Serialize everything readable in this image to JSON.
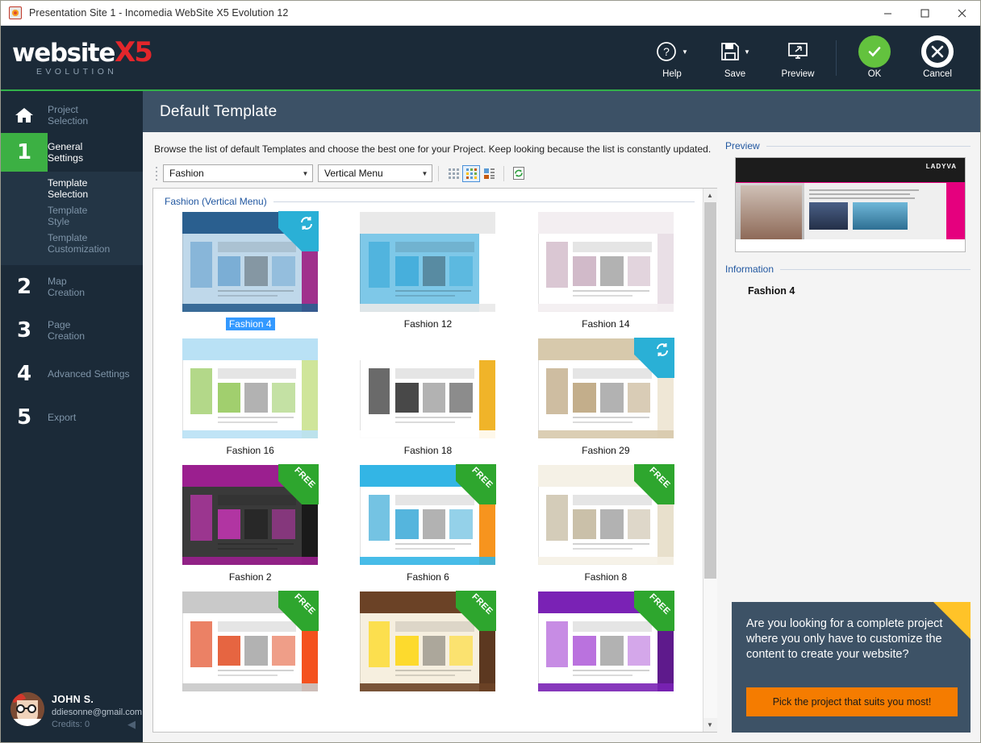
{
  "window": {
    "title": "Presentation Site 1 - Incomedia WebSite X5 Evolution 12",
    "app_icon": "app-logo-icon",
    "minimize": "minimize-icon",
    "maximize": "maximize-icon",
    "close": "close-icon"
  },
  "brand": {
    "line1": "website",
    "accent": "X5",
    "line2": "EVOLUTION",
    "accent_color": "#e3262b"
  },
  "toolbar": {
    "items": [
      {
        "label": "Help",
        "icon": "help-question-icon",
        "has_caret": true
      },
      {
        "label": "Save",
        "icon": "floppy-disk-icon",
        "has_caret": true
      },
      {
        "label": "Preview",
        "icon": "monitor-preview-icon",
        "has_caret": false
      }
    ],
    "ok": {
      "label": "OK",
      "icon": "check-icon",
      "color": "#63c23e"
    },
    "cancel": {
      "label": "Cancel",
      "icon": "cross-icon",
      "color": "#ffffff"
    }
  },
  "sidebar": {
    "home": {
      "label_line1": "Project",
      "label_line2": "Selection",
      "icon": "home-icon"
    },
    "steps": [
      {
        "number": "1",
        "label_line1": "General",
        "label_line2": "Settings",
        "active": true,
        "sub": [
          {
            "label_line1": "Template",
            "label_line2": "Selection",
            "selected": true
          },
          {
            "label_line1": "Template",
            "label_line2": "Style",
            "selected": false
          },
          {
            "label_line1": "Template",
            "label_line2": "Customization",
            "selected": false
          }
        ]
      },
      {
        "number": "2",
        "label_line1": "Map",
        "label_line2": "Creation",
        "active": false,
        "sub": []
      },
      {
        "number": "3",
        "label_line1": "Page",
        "label_line2": "Creation",
        "active": false,
        "sub": []
      },
      {
        "number": "4",
        "label_line1": "Advanced Settings",
        "label_line2": "",
        "active": false,
        "sub": []
      },
      {
        "number": "5",
        "label_line1": "Export",
        "label_line2": "",
        "active": false,
        "sub": []
      }
    ]
  },
  "user": {
    "name": "JOHN S.",
    "email": "ddiesonne@gmail.com",
    "credits": "Credits: 0",
    "avatar": "user-avatar",
    "collapse": "collapse-arrow-icon"
  },
  "page": {
    "title": "Default Template",
    "description": "Browse the list of default Templates and choose the best one for your Project. Keep looking because the list is constantly updated."
  },
  "filters": {
    "category": {
      "value": "Fashion",
      "caret": "chevron-down-icon"
    },
    "menu_type": {
      "value": "Vertical Menu",
      "caret": "chevron-down-icon"
    },
    "views": [
      {
        "name": "small-grid-view-icon",
        "selected": false
      },
      {
        "name": "medium-grid-view-icon",
        "selected": true
      },
      {
        "name": "detail-list-view-icon",
        "selected": false
      }
    ],
    "refresh": {
      "name": "refresh-templates-icon"
    }
  },
  "templates": {
    "group_label": "Fashion (Vertical Menu)",
    "selected": "Fashion 4",
    "items": [
      {
        "name": "Fashion 4",
        "badge": "sync",
        "selected": true,
        "art": {
          "header": "#2a5f8f",
          "body": "#bfd8ea",
          "side": "#a0308c",
          "accent": "#6aa4cf"
        }
      },
      {
        "name": "Fashion 12",
        "badge": "none",
        "selected": false,
        "art": {
          "header": "#e9e9e9",
          "body": "#7ec8e8",
          "side": "#ffffff",
          "accent": "#39a9d8"
        }
      },
      {
        "name": "Fashion 14",
        "badge": "none",
        "selected": false,
        "art": {
          "header": "#f3eef1",
          "body": "#ffffff",
          "side": "#e9dfe6",
          "accent": "#c6a9bb"
        }
      },
      {
        "name": "Fashion 16",
        "badge": "none",
        "selected": false,
        "art": {
          "header": "#b9e1f5",
          "body": "#ffffff",
          "side": "#cfe59a",
          "accent": "#8ac34a"
        }
      },
      {
        "name": "Fashion 18",
        "badge": "none",
        "selected": false,
        "art": {
          "header": "#ffffff",
          "body": "#ffffff",
          "side": "#f0b429",
          "accent": "#1a1a1a"
        }
      },
      {
        "name": "Fashion 29",
        "badge": "sync",
        "selected": false,
        "art": {
          "header": "#d7c9ac",
          "body": "#ffffff",
          "side": "#efe7d6",
          "accent": "#b49a6e"
        }
      },
      {
        "name": "Fashion 2",
        "badge": "free",
        "selected": false,
        "art": {
          "header": "#9b1f8f",
          "body": "#3a3a3a",
          "side": "#1a1a1a",
          "accent": "#cf34bd"
        }
      },
      {
        "name": "Fashion 6",
        "badge": "free",
        "selected": false,
        "art": {
          "header": "#33b5e5",
          "body": "#ffffff",
          "side": "#f7941e",
          "accent": "#2aa3d4"
        }
      },
      {
        "name": "Fashion 8",
        "badge": "free",
        "selected": false,
        "art": {
          "header": "#f5f1e6",
          "body": "#ffffff",
          "side": "#e8e0cc",
          "accent": "#bdb094"
        }
      },
      {
        "name": "",
        "badge": "free",
        "selected": false,
        "art": {
          "header": "#c9c9c9",
          "body": "#ffffff",
          "side": "#f4511e",
          "accent": "#e03e12"
        }
      },
      {
        "name": "",
        "badge": "free",
        "selected": false,
        "art": {
          "header": "#6b4226",
          "body": "#f6efdf",
          "side": "#5c3820",
          "accent": "#ffd500"
        }
      },
      {
        "name": "",
        "badge": "free",
        "selected": false,
        "art": {
          "header": "#7a22b5",
          "body": "#ffffff",
          "side": "#5e1a8c",
          "accent": "#a94fd6"
        }
      }
    ]
  },
  "right_panel": {
    "preview_label": "Preview",
    "preview_brand": "LADYVA",
    "information_label": "Information",
    "information_value": "Fashion 4"
  },
  "promo": {
    "text": "Are you looking for a complete project where you only have to customize the content to create your website?",
    "button": "Pick the project that suits you most!",
    "bg": "#3d5266",
    "button_bg": "#f57c00",
    "corner": "#ffc328"
  },
  "scrollbar": {
    "up": "scroll-up-icon",
    "down": "scroll-down-icon",
    "thumb_percent": 73
  }
}
